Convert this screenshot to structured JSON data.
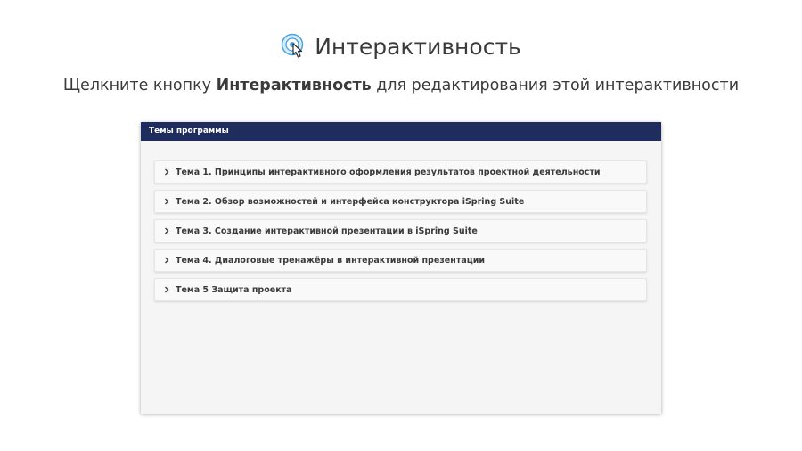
{
  "header": {
    "icon": "hand-pointer-icon",
    "title": "Интерактивность"
  },
  "subtitle": {
    "before": "Щелкните кнопку ",
    "bold": "Интерактивность",
    "after": " для редактирования этой интерактивности"
  },
  "panel": {
    "title": "Темы программы",
    "header_color": "#1e2d5e",
    "items": [
      {
        "icon": "chevron-right-icon",
        "label": "Тема 1. Принципы интерактивного оформления результатов проектной деятельности"
      },
      {
        "icon": "chevron-right-icon",
        "label": "Тема 2. Обзор возможностей и интерфейса конструктора iSpring Suite"
      },
      {
        "icon": "chevron-right-icon",
        "label": "Тема 3. Создание интерактивной презентации в iSpring Suite"
      },
      {
        "icon": "chevron-right-icon",
        "label": "Тема 4. Диалоговые тренажёры в интерактивной презентации"
      },
      {
        "icon": "chevron-right-icon",
        "label": "Тема 5 Защита проекта"
      }
    ]
  }
}
